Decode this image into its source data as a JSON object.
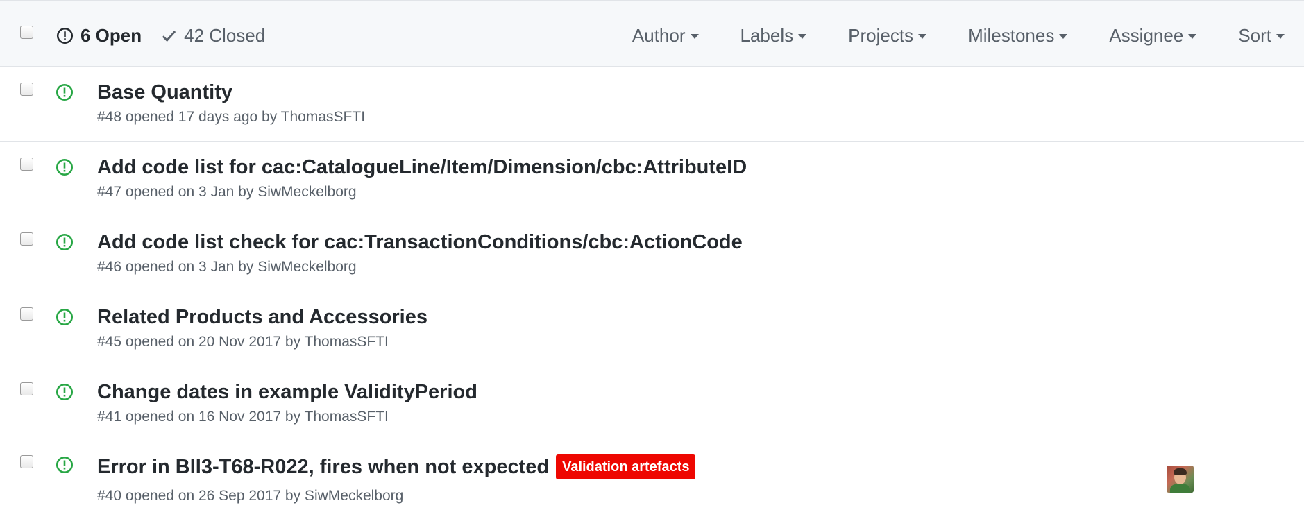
{
  "header": {
    "open_label": "6 Open",
    "closed_label": "42 Closed",
    "filters": {
      "author": "Author",
      "labels": "Labels",
      "projects": "Projects",
      "milestones": "Milestones",
      "assignee": "Assignee",
      "sort": "Sort"
    }
  },
  "issues": [
    {
      "title": "Base Quantity",
      "meta": "#48 opened 17 days ago by ThomasSFTI"
    },
    {
      "title": "Add code list for cac:CatalogueLine/Item/Dimension/cbc:AttributeID",
      "meta": "#47 opened on 3 Jan by SiwMeckelborg"
    },
    {
      "title": "Add code list check for cac:TransactionConditions/cbc:ActionCode",
      "meta": "#46 opened on 3 Jan by SiwMeckelborg"
    },
    {
      "title": "Related Products and Accessories",
      "meta": "#45 opened on 20 Nov 2017 by ThomasSFTI"
    },
    {
      "title": "Change dates in example ValidityPeriod",
      "meta": "#41 opened on 16 Nov 2017 by ThomasSFTI"
    },
    {
      "title": "Error in BII3-T68-R022, fires when not expected",
      "meta": "#40 opened on 26 Sep 2017 by SiwMeckelborg",
      "label": "Validation artefacts"
    }
  ],
  "icons": {
    "open": "issue-opened-icon",
    "closed": "check-icon",
    "caret": "caret-down-icon"
  },
  "colors": {
    "open_green": "#28a745",
    "label_red": "#ee0701",
    "header_bg": "#f6f8fa",
    "muted_text": "#586069"
  }
}
